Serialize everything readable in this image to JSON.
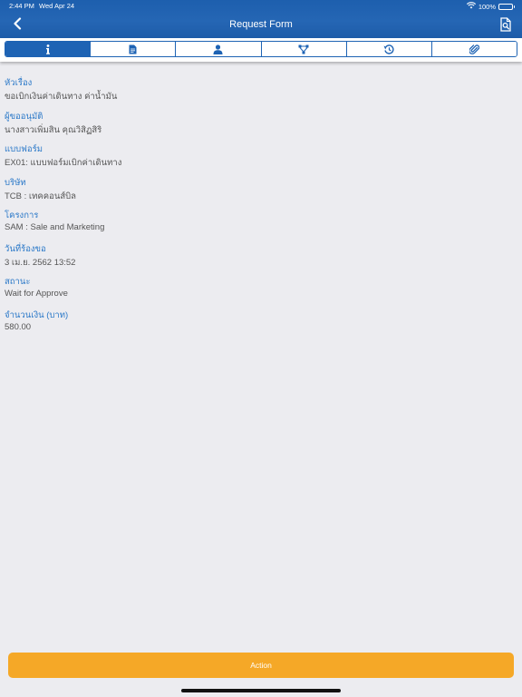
{
  "status_bar": {
    "time": "2:44 PM",
    "date": "Wed Apr 24",
    "battery": "100%"
  },
  "header": {
    "title": "Request Form",
    "back_icon": "chevron-left-icon",
    "right_icon": "document-search-icon"
  },
  "tabs": [
    {
      "icon": "info-icon",
      "active": true
    },
    {
      "icon": "document-icon",
      "active": false
    },
    {
      "icon": "person-icon",
      "active": false
    },
    {
      "icon": "workflow-icon",
      "active": false
    },
    {
      "icon": "history-icon",
      "active": false
    },
    {
      "icon": "paperclip-icon",
      "active": false
    }
  ],
  "fields": [
    {
      "label": "หัวเรื่อง",
      "value": "ขอเบิกเงินค่าเดินทาง ค่าน้ำมัน"
    },
    {
      "label": "ผู้ขออนุมัติ",
      "value": "นางสาวเพิ่มสิน คุณวิสิฏสิริ"
    },
    {
      "label": "แบบฟอร์ม",
      "value": "EX01: แบบฟอร์มเบิกค่าเดินทาง"
    },
    {
      "label": "บริษัท",
      "value": "TCB : เทคคอนส์บิล"
    },
    {
      "label": "โครงการ",
      "value": "SAM : Sale and Marketing"
    },
    {
      "label": "วันที่ร้องขอ",
      "value": "3 เม.ย. 2562  13:52"
    },
    {
      "label": "สถานะ",
      "value": "Wait for Approve"
    },
    {
      "label": "จำนวนเงิน (บาท)",
      "value": "580.00"
    }
  ],
  "action": {
    "label": "Action"
  },
  "colors": {
    "header_blue": "#1e63b4",
    "label_blue": "#2a78c8",
    "action_orange": "#f5a827",
    "background": "#ececf0"
  }
}
